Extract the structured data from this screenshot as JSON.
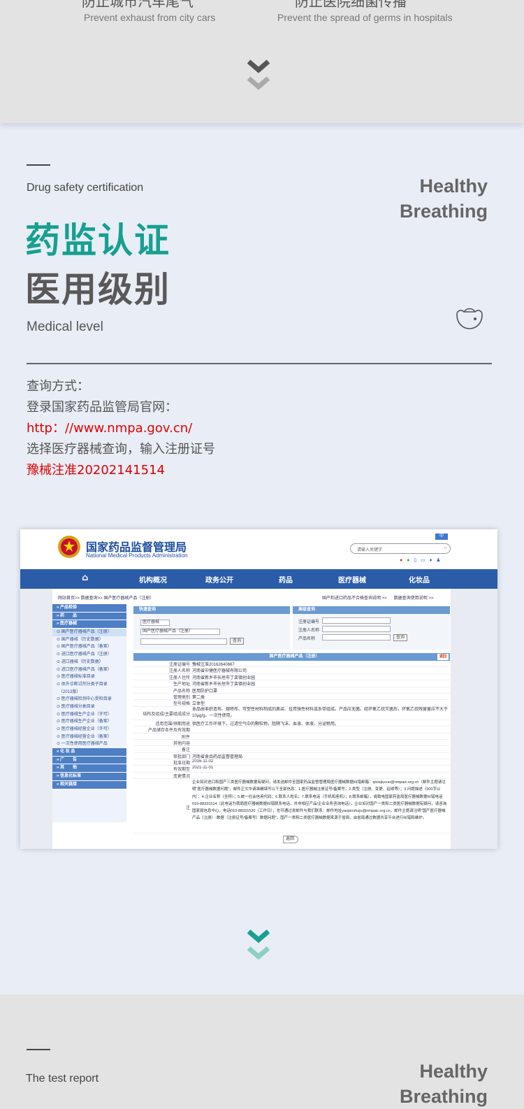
{
  "benefits": [
    {
      "cn": "防止城市汽车尾气",
      "en": "Prevent exhaust from city cars"
    },
    {
      "cn": "防止医院细菌传播",
      "en": "Prevent the spread of germs in hospitals"
    }
  ],
  "cert": {
    "subtitle_en": "Drug safety certification",
    "healthy": "Healthy",
    "breathing": "Breathing",
    "title1": "药监认证",
    "title2": "医用级别",
    "subtitle2_en": "Medical level",
    "query": [
      {
        "text": "查询方式：",
        "red": false
      },
      {
        "text": "登录国家药品监管局官网：",
        "red": false
      },
      {
        "text": "http：//www.nmpa.gov.cn/",
        "red": true
      },
      {
        "text": "选择医疗器械查询，输入注册证号",
        "red": false
      },
      {
        "text": "豫械注准20202141514",
        "red": true
      }
    ]
  },
  "shot": {
    "agency_cn": "国家药品监督管理局",
    "agency_en": "National Medical Products Administration",
    "lang": "中",
    "search_placeholder": "请输入关键字",
    "nav": [
      "机构概况",
      "政务公开",
      "药品",
      "医疗器械",
      "化妆品"
    ],
    "breadcrumb": "网站首页>> 数据查询>> 国产医疗器械产品（注册）",
    "top_links": "国产和进口药品不合格查询说明 >>      数据查询使用说明 >>",
    "sidebar": [
      {
        "label": "» 产品检验",
        "type": "hd"
      },
      {
        "label": "» 药　　品",
        "type": "hd"
      },
      {
        "label": "» 医疗器械",
        "type": "hd"
      },
      {
        "label": "⊙ 国产医疗器械产品（注册）",
        "type": "sel"
      },
      {
        "label": "⊙ 国产器械（历史数据）",
        "type": ""
      },
      {
        "label": "⊙ 国产医疗器械产品（备案）",
        "type": ""
      },
      {
        "label": "⊙ 进口医疗器械产品（注册）",
        "type": ""
      },
      {
        "label": "⊙ 进口器械（历史数据）",
        "type": ""
      },
      {
        "label": "⊙ 进口医疗器械产品（备案）",
        "type": ""
      },
      {
        "label": "⊙ 医疗器械标准目录",
        "type": ""
      },
      {
        "label": "⊙ 体外诊断试剂分类子目录",
        "type": ""
      },
      {
        "label": "　（2013版）",
        "type": ""
      },
      {
        "label": "⊙ 医疗器械检测中心受检目录",
        "type": ""
      },
      {
        "label": "⊙ 医疗器械分类目录",
        "type": ""
      },
      {
        "label": "⊙ 医疗器械生产企业（许可）",
        "type": ""
      },
      {
        "label": "⊙ 医疗器械生产企业（备案）",
        "type": ""
      },
      {
        "label": "⊙ 医疗器械经营企业（许可）",
        "type": ""
      },
      {
        "label": "⊙ 医疗器械经营企业（备案）",
        "type": ""
      },
      {
        "label": "⊙ 一次性使用医疗器械产品",
        "type": ""
      },
      {
        "label": "» 化 妆 品",
        "type": "hd"
      },
      {
        "label": "» 广　　告",
        "type": "hd"
      },
      {
        "label": "» 其　　他",
        "type": "hd"
      },
      {
        "label": "» 信息化标准",
        "type": "hd"
      },
      {
        "label": "» 相关链接",
        "type": "hd"
      }
    ],
    "quick_title": "快速查询",
    "adv_title": "高级查询",
    "select1": "医疗器械",
    "select2": "国产医疗器械产品（注册）",
    "search_btn": "查询",
    "adv_fields": [
      "注册证编号",
      "注册人名称",
      "产品名称"
    ],
    "table_title": "国产医疗器械产品（注册）",
    "back": "返回",
    "rows": [
      {
        "k": "注册证编号",
        "v": "豫械注准20162640667"
      },
      {
        "k": "注册人名称",
        "v": "河南省中捷医疗器械有限公司"
      },
      {
        "k": "注册人住所",
        "v": "河南省新乡市长垣市丁栾镇创业园"
      },
      {
        "k": "生产地址",
        "v": "河南省新乡市长垣市丁栾镇创业园"
      },
      {
        "k": "产品名称",
        "v": "医用防护口罩"
      },
      {
        "k": "管理类别",
        "v": "第二类"
      },
      {
        "k": "型号规格",
        "v": "立体型"
      },
      {
        "k": "结构及组成/主要组成成分",
        "v": "本品由非织造布、熔喷布、可塑性材料制成的鼻梁、挂耳弹性材料或系带组成。产品应无菌。经环氧乙烷灭菌后，环氧乙烷残留量应不大于10μg/g。一次性使用。"
      },
      {
        "k": "适用范围/预期用途",
        "v": "供医疗工作环境下，过滤空气中的颗粒物，阻隔飞沫、血液、体液、分泌物用。"
      },
      {
        "k": "产品储存条件及有效期",
        "v": ""
      },
      {
        "k": "附件",
        "v": ""
      },
      {
        "k": "其他内容",
        "v": ""
      },
      {
        "k": "备注",
        "v": ""
      },
      {
        "k": "审批部门",
        "v": "河南省食品药品监督管理局"
      },
      {
        "k": "批准日期",
        "v": "2016-11-02"
      },
      {
        "k": "有效期至",
        "v": "2021-11-01"
      },
      {
        "k": "变更情况",
        "v": ""
      }
    ],
    "note_label": "注",
    "note": "企业如对进口和国产三类医疗器械数据有疑问，请发送邮件至国家药品监督管理局医疗器械数据纠错邮箱：qixiejiucuo@nmpaic.org.cn（邮件主题请注明“医疗器械数据问题”，邮件正文中请准确填写以下全部信息：1.医疗器械注册证号/备案号；2.类型（注册、变更、延续等）；3.问题描述（500字以内）；4.企业名称（全称）；5.统一社会信用代码；6.联系人姓名；7.联系电话（手机和座机）；8.联系邮箱），或致电国家药监局医疗器械数据纠错电话010-88331514（此电话为我局医疗器械数据纠错联系电话，并非相应产品/企业业务咨询电话）。企业如对国产一类和二类医疗器械数据有疑问，请咨询国家局信息中心，电话010-88331520（工作日），也可通过发邮件与我们联系：邮件地址yaopinshuju@nmpaic.org.cn，邮件主题请注明“国产医疗器械产品（注册）-数据（注册证号/备案号）数据问题”。国产一类和二类医疗器械数据来源于省局，由省局通过数据共享平台进行纠错和维护。",
    "bottom_back": "返回"
  },
  "report": {
    "subtitle_en": "The test report",
    "healthy": "Healthy",
    "breathing": "Breathing"
  },
  "colors": {
    "teal": "#16a090",
    "red": "#e00000",
    "nav_blue": "#2a5ca8"
  }
}
